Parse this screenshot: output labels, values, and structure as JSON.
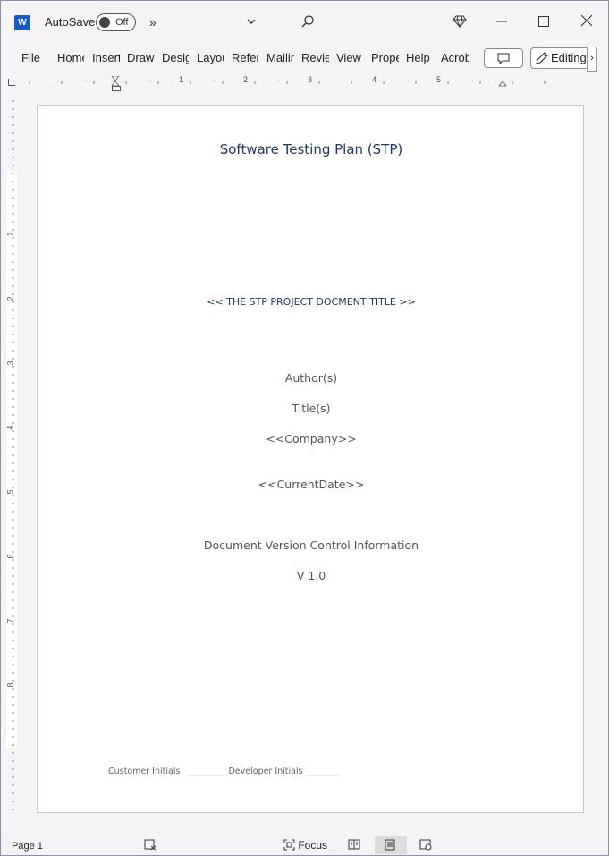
{
  "titlebar": {
    "autosave_label": "AutoSave",
    "autosave_state": "Off",
    "app_logo_letter": "W"
  },
  "ribbon": {
    "tabs": [
      "File",
      "Home",
      "Insert",
      "Draw",
      "Design",
      "Layout",
      "References",
      "Mailings",
      "Review",
      "View",
      "Properties",
      "Help",
      "Acrobat"
    ],
    "editing_label": "Editing"
  },
  "ruler": {
    "h_numbers": [
      "1",
      "2",
      "3",
      "4",
      "5"
    ],
    "v_numbers": [
      "1",
      "2",
      "3",
      "4",
      "5",
      "6",
      "7",
      "8"
    ]
  },
  "document": {
    "title": "Software Testing Plan (STP)",
    "subtitle": "<< THE STP PROJECT DOCMENT TITLE >>",
    "authors": "Author(s)",
    "titles": "Title(s)",
    "company": "<<Company>>",
    "current_date": "<<CurrentDate>>",
    "version_heading": "Document Version Control Information",
    "version": "V 1.0",
    "footer_customer": "Customer Initials",
    "footer_developer": "Developer Initials",
    "footer_blank": "________"
  },
  "statusbar": {
    "page": "Page 1",
    "focus": "Focus"
  }
}
